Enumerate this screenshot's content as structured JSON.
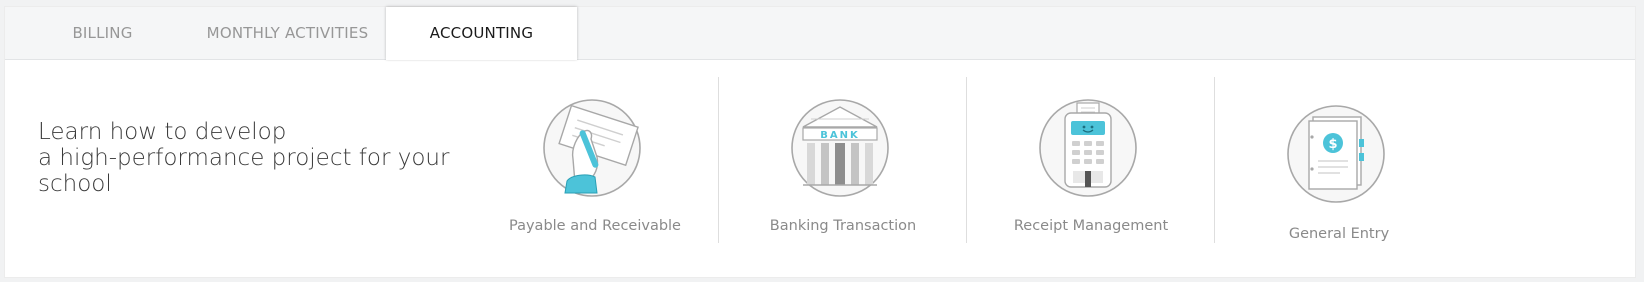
{
  "tabs": [
    {
      "label": "BILLING",
      "active": false
    },
    {
      "label": "MONTHLY ACTIVITIES",
      "active": false
    },
    {
      "label": "ACCOUNTING",
      "active": true
    }
  ],
  "headline": {
    "line1": "Learn how to develop",
    "line2": "a high-performance project for your",
    "line3": "school"
  },
  "cards": [
    {
      "label": "Payable and Receivable",
      "icon": "payable-receivable-icon"
    },
    {
      "label": "Banking Transaction",
      "icon": "bank-icon",
      "icon_text": "BANK"
    },
    {
      "label": "Receipt Management",
      "icon": "receipt-terminal-icon"
    },
    {
      "label": "General Entry",
      "icon": "ledger-book-icon",
      "icon_text": "$"
    }
  ],
  "colors": {
    "accent": "#4cc3d9",
    "outline": "#a8a8a8",
    "text": "#8a8a8a"
  }
}
